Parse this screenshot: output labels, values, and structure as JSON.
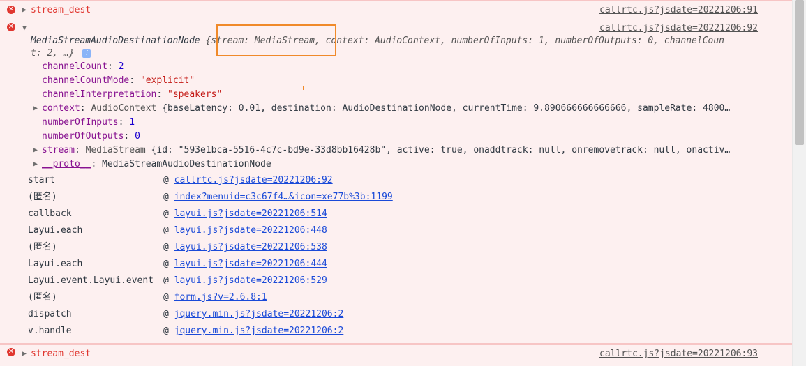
{
  "messages": [
    {
      "label": "stream_dest",
      "source": "callrtc.js?jsdate=20221206:91"
    },
    {
      "source": "callrtc.js?jsdate=20221206:92"
    },
    {
      "label": "stream_dest",
      "source": "callrtc.js?jsdate=20221206:93"
    }
  ],
  "object": {
    "class_name": "MediaStreamAudioDestinationNode",
    "summary_line1": "{stream: MediaStream, context: AudioContext, numberOfInputs: 1, numberOfOutputs: 0, channelCoun",
    "summary_line2": "t: 2, …}",
    "info_glyph": "i",
    "properties": [
      {
        "key": "channelCount",
        "value": "2",
        "type": "num"
      },
      {
        "key": "channelCountMode",
        "value": "\"explicit\"",
        "type": "str"
      },
      {
        "key": "channelInterpretation",
        "value": "\"speakers\"",
        "type": "str"
      },
      {
        "key": "context",
        "value_class": "AudioContext",
        "value": "{baseLatency: 0.01, destination: AudioDestinationNode, currentTime: 9.890666666666666, sampleRate: 4800…",
        "expandable": true
      },
      {
        "key": "numberOfInputs",
        "value": "1",
        "type": "num"
      },
      {
        "key": "numberOfOutputs",
        "value": "0",
        "type": "num"
      },
      {
        "key": "stream",
        "value_class": "MediaStream",
        "value": "{id: \"593e1bca-5516-4c7c-bd9e-33d8bb16428b\", active: true, onaddtrack: null, onremovetrack: null, onactiv…",
        "expandable": true
      },
      {
        "key": "__proto__",
        "value": "MediaStreamAudioDestinationNode",
        "expandable": true,
        "proto": true
      }
    ]
  },
  "stack": [
    {
      "fn": "start",
      "link": "callrtc.js?jsdate=20221206:92"
    },
    {
      "fn": "(匿名)",
      "link": "index?menuid=c3c67f4…&icon=xe77b%3b:1199"
    },
    {
      "fn": "callback",
      "link": "layui.js?jsdate=20221206:514"
    },
    {
      "fn": "Layui.each",
      "link": "layui.js?jsdate=20221206:448"
    },
    {
      "fn": "(匿名)",
      "link": "layui.js?jsdate=20221206:538"
    },
    {
      "fn": "Layui.each",
      "link": "layui.js?jsdate=20221206:444"
    },
    {
      "fn": "Layui.event.Layui.event",
      "link": "layui.js?jsdate=20221206:529"
    },
    {
      "fn": "(匿名)",
      "link": "form.js?v=2.6.8:1"
    },
    {
      "fn": "dispatch",
      "link": "jquery.min.js?jsdate=20221206:2"
    },
    {
      "fn": "v.handle",
      "link": "jquery.min.js?jsdate=20221206:2"
    }
  ],
  "glyphs": {
    "error": "✕",
    "expand": "▶",
    "collapse": "▼",
    "at": "@"
  },
  "colors": {
    "error": "#e0362f",
    "highlight": "#f08a2a",
    "link": "#1a4ad8"
  }
}
